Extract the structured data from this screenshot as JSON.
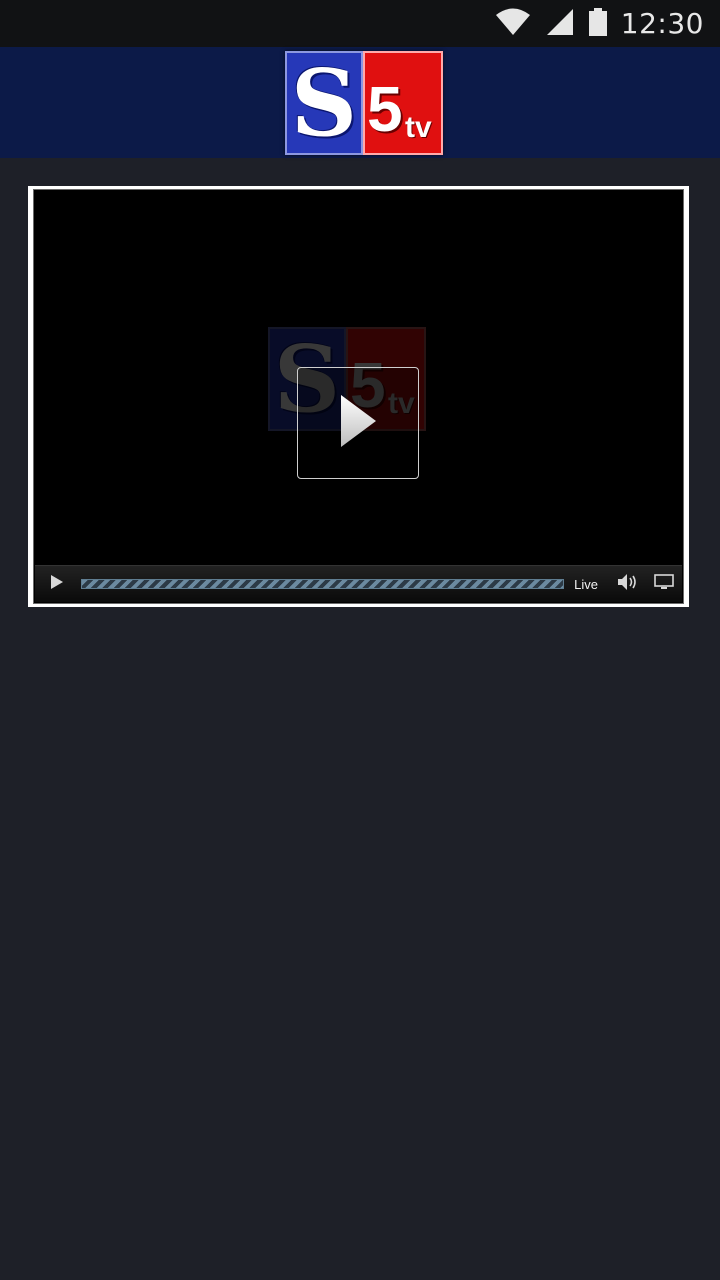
{
  "status_bar": {
    "time": "12:30",
    "icons": [
      "wifi-icon",
      "cell-signal-icon",
      "battery-icon"
    ]
  },
  "header": {
    "logo": {
      "letter": "S",
      "number": "5",
      "suffix": "tv"
    },
    "colors": {
      "header_bg": "#0c1a48",
      "logo_blue": "#2638b8",
      "logo_red": "#e01010"
    }
  },
  "player": {
    "poster_logo": {
      "letter": "S",
      "number": "5",
      "suffix": "tv"
    },
    "controls": {
      "play_icon": "play-icon",
      "live_label": "Live",
      "volume_icon": "volume-icon",
      "fullscreen_icon": "fullscreen-icon"
    }
  },
  "colors": {
    "page_bg": "#1e2028",
    "status_bg": "#111214"
  }
}
